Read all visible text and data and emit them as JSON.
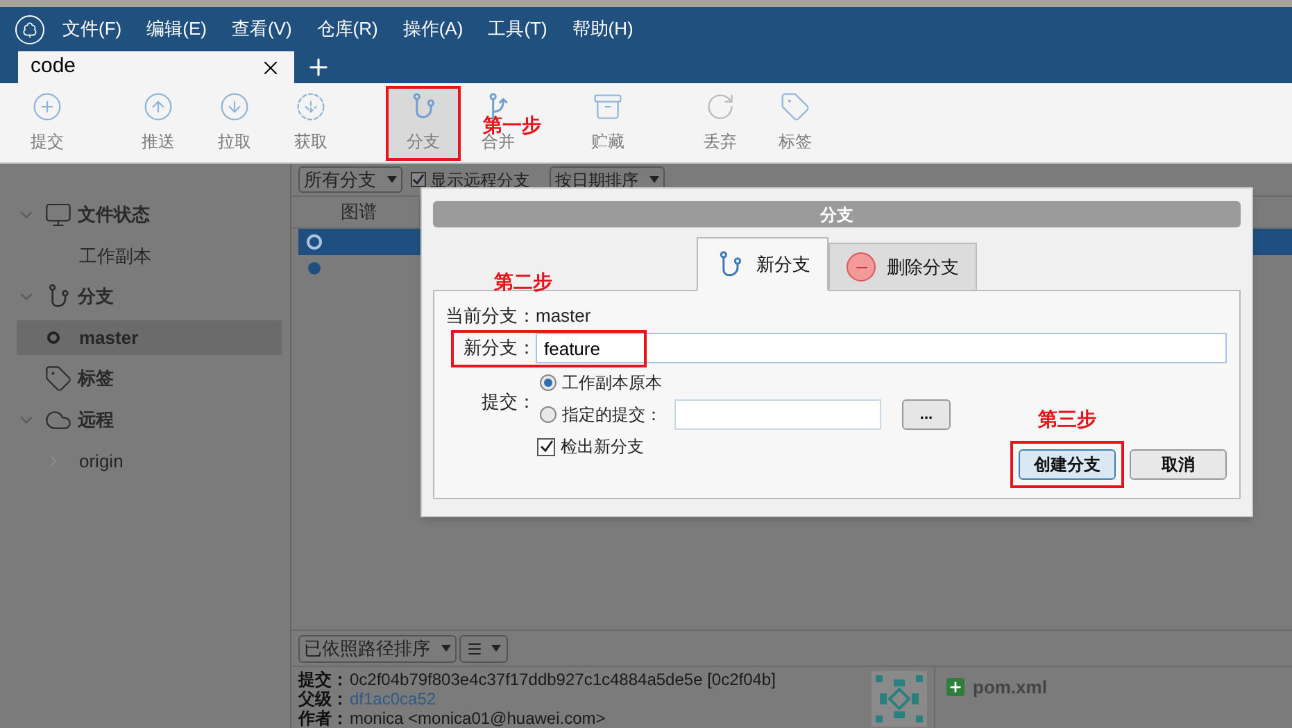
{
  "menu": [
    "文件(F)",
    "编辑(E)",
    "查看(V)",
    "仓库(R)",
    "操作(A)",
    "工具(T)",
    "帮助(H)"
  ],
  "tabs": [
    {
      "label": "code",
      "selected": true
    }
  ],
  "toolbar": [
    {
      "kind": "commit",
      "label": "提交",
      "highlighted": false
    },
    {
      "kind": "push",
      "label": "推送",
      "highlighted": false
    },
    {
      "kind": "pull",
      "label": "拉取",
      "highlighted": false
    },
    {
      "kind": "fetch",
      "label": "获取",
      "highlighted": false
    },
    {
      "kind": "branch",
      "label": "分支",
      "highlighted": true,
      "annotation": "第一步"
    },
    {
      "kind": "merge",
      "label": "合并",
      "highlighted": false
    },
    {
      "kind": "stash",
      "label": "贮藏",
      "highlighted": false
    },
    {
      "kind": "discard",
      "label": "丢弃",
      "highlighted": false
    },
    {
      "kind": "tag",
      "label": "标签",
      "highlighted": false
    }
  ],
  "sidebar": [
    {
      "kind": "monitor",
      "label": "文件状态",
      "expanded": true,
      "children": [
        {
          "label": "工作副本",
          "selected": false
        }
      ]
    },
    {
      "kind": "branch",
      "label": "分支",
      "expanded": true,
      "children": [
        {
          "label": "master",
          "selected": true
        }
      ]
    },
    {
      "kind": "tag",
      "label": "标签"
    },
    {
      "kind": "cloud",
      "label": "远程",
      "expanded": true,
      "children": [
        {
          "label": "origin",
          "selected": false,
          "expanded": false
        }
      ]
    }
  ],
  "filter_bar": {
    "branch_filter": "所有分支",
    "show_remote": {
      "label": "显示远程分支",
      "checked": true
    },
    "sort": "按日期排序"
  },
  "commit_list": {
    "columns": [
      "图谱"
    ],
    "rows": [
      {
        "selected": true
      },
      {
        "selected": false
      }
    ]
  },
  "dialog": {
    "title": "分支",
    "tabs": [
      {
        "kind": "new",
        "label": "新分支",
        "selected": true
      },
      {
        "kind": "delete",
        "label": "删除分支",
        "selected": false
      }
    ],
    "current_branch": {
      "label": "当前分支：",
      "value": "master"
    },
    "new_branch": {
      "label": "新分支：",
      "value": "feature",
      "highlighted": true,
      "annotation": "第二步"
    },
    "commit": {
      "label": "提交：",
      "options": [
        {
          "label": "工作副本原本",
          "selected": true
        },
        {
          "label": "指定的提交：",
          "selected": false
        }
      ],
      "browse": "..."
    },
    "checkout": {
      "label": "检出新分支",
      "checked": true
    },
    "buttons": [
      {
        "label": "创建分支",
        "primary": true,
        "highlighted": true,
        "annotation": "第三步"
      },
      {
        "label": "取消",
        "primary": false,
        "highlighted": false
      }
    ]
  },
  "file_bar": {
    "sort": "已依照路径排序"
  },
  "details": [
    {
      "label": "提交：",
      "value": "0c2f04b79f803e4c37f17ddb927c1c4884a5de5e [0c2f04b]",
      "link": false
    },
    {
      "label": "父级：",
      "value": "df1ac0ca52",
      "link": true
    },
    {
      "label": "作者：",
      "value": "monica <monica01@huawei.com>",
      "link": false
    }
  ],
  "files": [
    {
      "name": "pom.xml"
    }
  ]
}
